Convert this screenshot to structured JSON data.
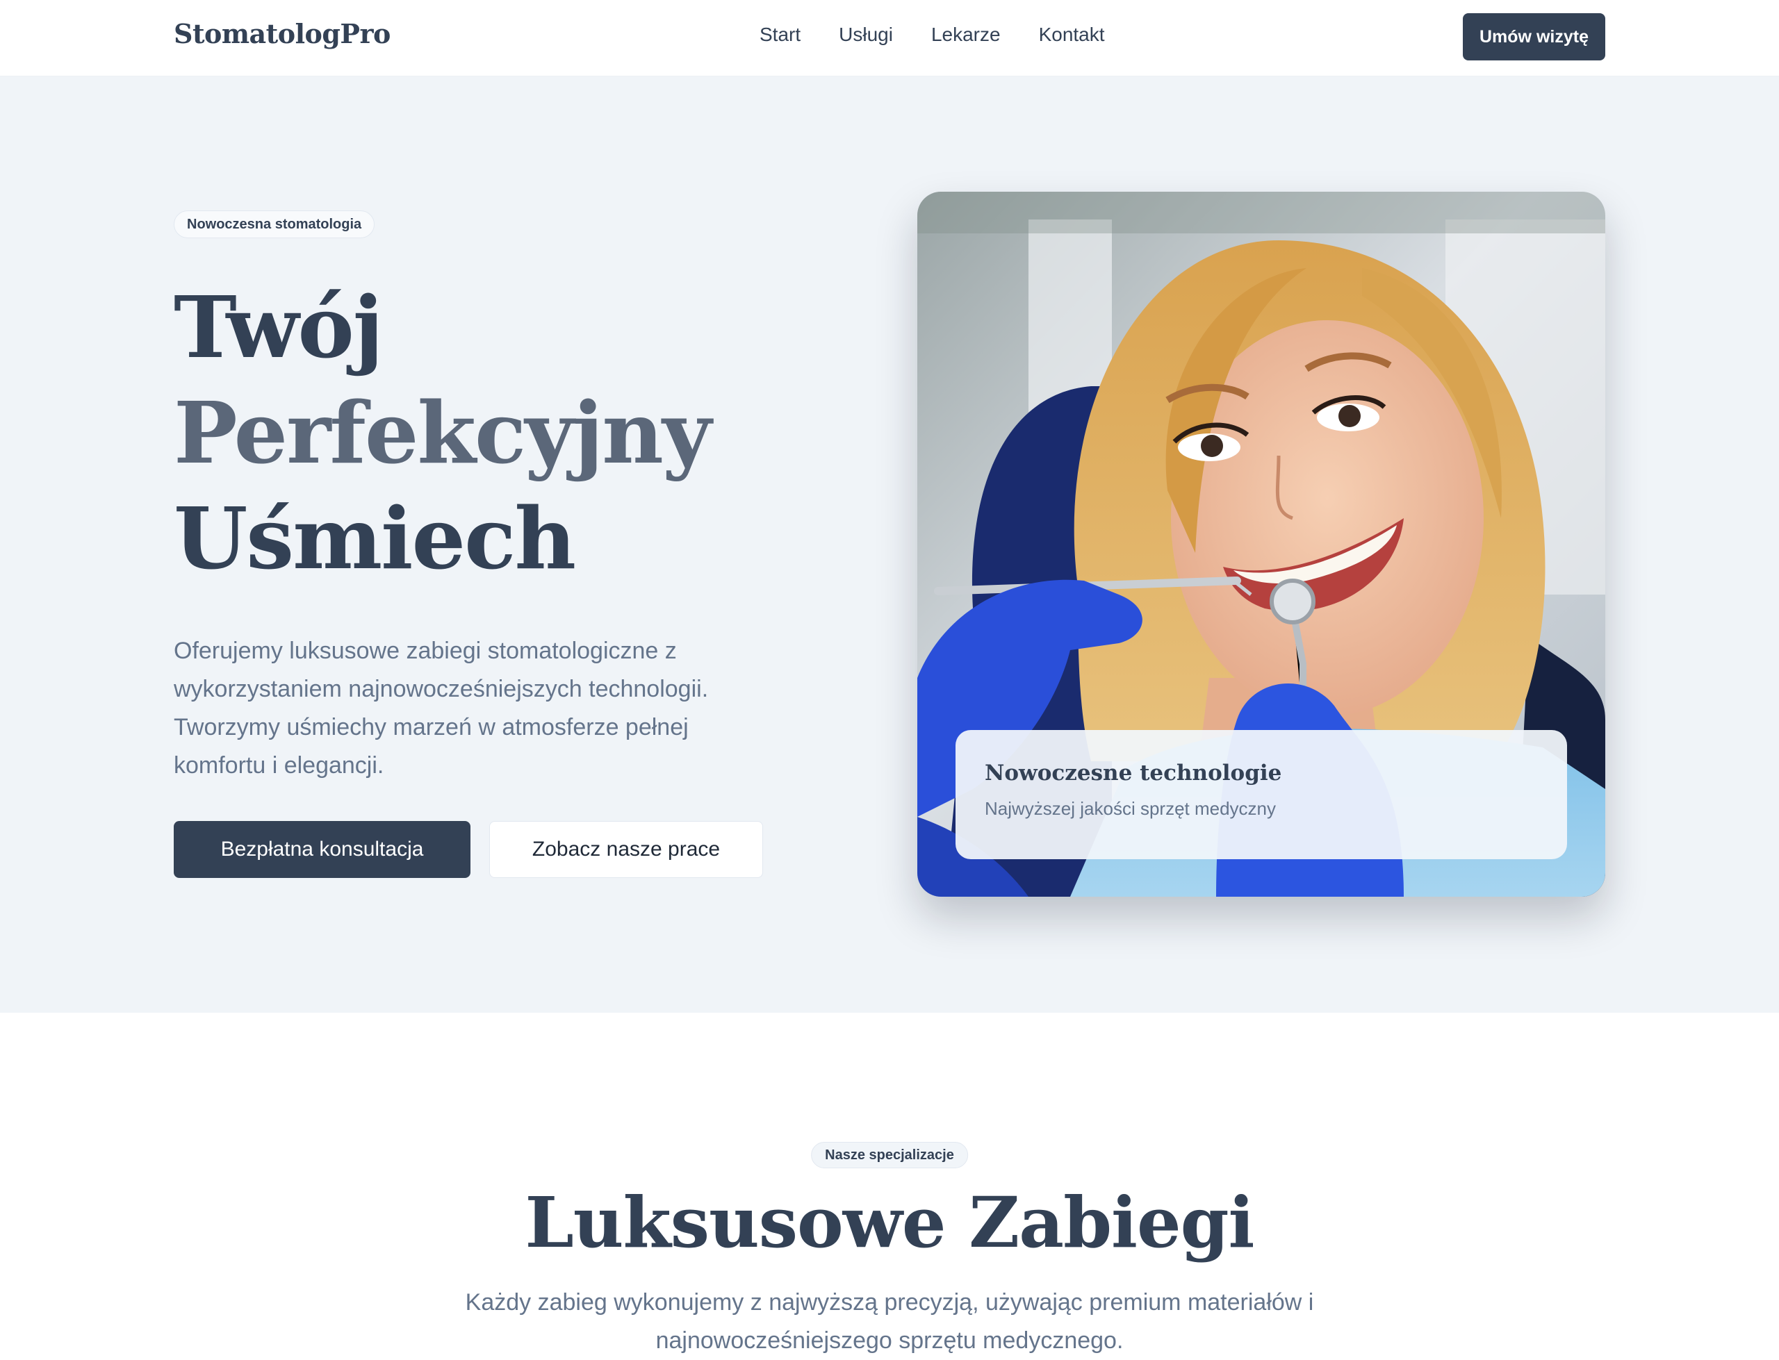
{
  "nav": {
    "logo": "StomatologPro",
    "links": [
      "Start",
      "Usługi",
      "Lekarze",
      "Kontakt"
    ],
    "cta": "Umów wizytę"
  },
  "hero": {
    "badge": "Nowoczesna stomatologia",
    "title_line1": "Twój",
    "title_line2": "Perfekcyjny",
    "title_line3": "Uśmiech",
    "description": "Oferujemy luksusowe zabiegi stomatologiczne z wykorzystaniem najnowocześniejszych technologii. Tworzymy uśmiechy marzeń w atmosferze pełnej komfortu i elegancji.",
    "primary_button": "Bezpłatna konsultacja",
    "secondary_button": "Zobacz nasze prace",
    "card_title": "Nowoczesne technologie",
    "card_subtitle": "Najwyższej jakości sprzęt medyczny"
  },
  "services": {
    "badge": "Nasze specjalizacje",
    "title": "Luksusowe Zabiegi",
    "description": "Każdy zabieg wykonujemy z najwyższą precyzją, używając premium materiałów i najnowocześniejszego sprzętu medycznego."
  },
  "colors": {
    "primary": "#334155",
    "hero_background": "#f0f4f8",
    "muted_text": "#64748b"
  }
}
